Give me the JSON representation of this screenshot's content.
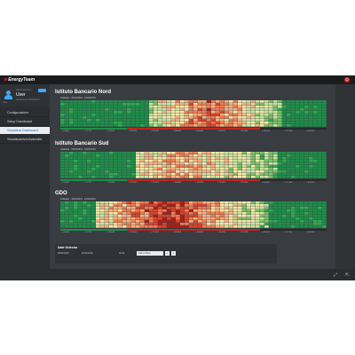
{
  "app": {
    "logo_text": "EnergyTeam",
    "logo_mark": "≋"
  },
  "user": {
    "welcome": "Ultimo accesso",
    "name": "User",
    "last_access": "dal accesso 10/04/2019",
    "role": "User"
  },
  "nav": [
    {
      "label": "Configurazione",
      "active": false
    },
    {
      "label": "Setup Dashboard",
      "active": false
    },
    {
      "label": "Visualizza Dashboard",
      "active": true
    },
    {
      "label": "Visualizzazioni Avanzate",
      "active": false
    }
  ],
  "charts": [
    {
      "title": "Istituto Bancario Nord",
      "subtitle": "Gallarate - 09/04/2019 - 10/04/2019"
    },
    {
      "title": "Istituto Bancario Sud",
      "subtitle": "Gallarate - 09/04/2019 - 10/04/2019"
    },
    {
      "title": "GDO",
      "subtitle": "Gallarate - 09/04/2019 - 10/04/2019"
    }
  ],
  "x_ticks": [
    "< 0.0000",
    "< 7.7773",
    "< 15.5546",
    "< 23.3319",
    "< 31.1092",
    "< 38.8865",
    "< 46.6638",
    "< 54.4411",
    "< 62.2184",
    "< 69.9957",
    "< 77.7730",
    "< 85.5503"
  ],
  "date_selector": {
    "title": "Date Selector",
    "from": "09/04/2019",
    "to": "10/04/2019",
    "time": "00:00",
    "preset": "Ultimo Mese",
    "prev": "«",
    "next": "»"
  },
  "colors": {
    "accent": "#3fa9f5",
    "brand": "#e2231a",
    "green": "#1e8e4a",
    "red": "#c0261e"
  }
}
